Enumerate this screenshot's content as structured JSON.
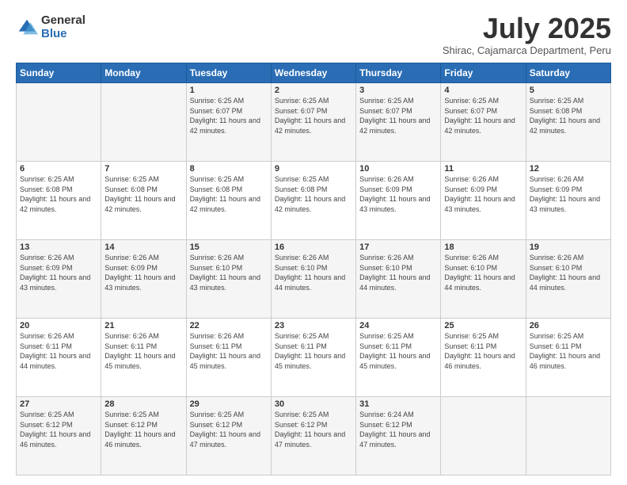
{
  "logo": {
    "general": "General",
    "blue": "Blue"
  },
  "header": {
    "month": "July 2025",
    "location": "Shirac, Cajamarca Department, Peru"
  },
  "days_of_week": [
    "Sunday",
    "Monday",
    "Tuesday",
    "Wednesday",
    "Thursday",
    "Friday",
    "Saturday"
  ],
  "weeks": [
    [
      {
        "day": "",
        "info": ""
      },
      {
        "day": "",
        "info": ""
      },
      {
        "day": "1",
        "info": "Sunrise: 6:25 AM\nSunset: 6:07 PM\nDaylight: 11 hours and 42 minutes."
      },
      {
        "day": "2",
        "info": "Sunrise: 6:25 AM\nSunset: 6:07 PM\nDaylight: 11 hours and 42 minutes."
      },
      {
        "day": "3",
        "info": "Sunrise: 6:25 AM\nSunset: 6:07 PM\nDaylight: 11 hours and 42 minutes."
      },
      {
        "day": "4",
        "info": "Sunrise: 6:25 AM\nSunset: 6:07 PM\nDaylight: 11 hours and 42 minutes."
      },
      {
        "day": "5",
        "info": "Sunrise: 6:25 AM\nSunset: 6:08 PM\nDaylight: 11 hours and 42 minutes."
      }
    ],
    [
      {
        "day": "6",
        "info": "Sunrise: 6:25 AM\nSunset: 6:08 PM\nDaylight: 11 hours and 42 minutes."
      },
      {
        "day": "7",
        "info": "Sunrise: 6:25 AM\nSunset: 6:08 PM\nDaylight: 11 hours and 42 minutes."
      },
      {
        "day": "8",
        "info": "Sunrise: 6:25 AM\nSunset: 6:08 PM\nDaylight: 11 hours and 42 minutes."
      },
      {
        "day": "9",
        "info": "Sunrise: 6:25 AM\nSunset: 6:08 PM\nDaylight: 11 hours and 42 minutes."
      },
      {
        "day": "10",
        "info": "Sunrise: 6:26 AM\nSunset: 6:09 PM\nDaylight: 11 hours and 43 minutes."
      },
      {
        "day": "11",
        "info": "Sunrise: 6:26 AM\nSunset: 6:09 PM\nDaylight: 11 hours and 43 minutes."
      },
      {
        "day": "12",
        "info": "Sunrise: 6:26 AM\nSunset: 6:09 PM\nDaylight: 11 hours and 43 minutes."
      }
    ],
    [
      {
        "day": "13",
        "info": "Sunrise: 6:26 AM\nSunset: 6:09 PM\nDaylight: 11 hours and 43 minutes."
      },
      {
        "day": "14",
        "info": "Sunrise: 6:26 AM\nSunset: 6:09 PM\nDaylight: 11 hours and 43 minutes."
      },
      {
        "day": "15",
        "info": "Sunrise: 6:26 AM\nSunset: 6:10 PM\nDaylight: 11 hours and 43 minutes."
      },
      {
        "day": "16",
        "info": "Sunrise: 6:26 AM\nSunset: 6:10 PM\nDaylight: 11 hours and 44 minutes."
      },
      {
        "day": "17",
        "info": "Sunrise: 6:26 AM\nSunset: 6:10 PM\nDaylight: 11 hours and 44 minutes."
      },
      {
        "day": "18",
        "info": "Sunrise: 6:26 AM\nSunset: 6:10 PM\nDaylight: 11 hours and 44 minutes."
      },
      {
        "day": "19",
        "info": "Sunrise: 6:26 AM\nSunset: 6:10 PM\nDaylight: 11 hours and 44 minutes."
      }
    ],
    [
      {
        "day": "20",
        "info": "Sunrise: 6:26 AM\nSunset: 6:11 PM\nDaylight: 11 hours and 44 minutes."
      },
      {
        "day": "21",
        "info": "Sunrise: 6:26 AM\nSunset: 6:11 PM\nDaylight: 11 hours and 45 minutes."
      },
      {
        "day": "22",
        "info": "Sunrise: 6:26 AM\nSunset: 6:11 PM\nDaylight: 11 hours and 45 minutes."
      },
      {
        "day": "23",
        "info": "Sunrise: 6:25 AM\nSunset: 6:11 PM\nDaylight: 11 hours and 45 minutes."
      },
      {
        "day": "24",
        "info": "Sunrise: 6:25 AM\nSunset: 6:11 PM\nDaylight: 11 hours and 45 minutes."
      },
      {
        "day": "25",
        "info": "Sunrise: 6:25 AM\nSunset: 6:11 PM\nDaylight: 11 hours and 46 minutes."
      },
      {
        "day": "26",
        "info": "Sunrise: 6:25 AM\nSunset: 6:11 PM\nDaylight: 11 hours and 46 minutes."
      }
    ],
    [
      {
        "day": "27",
        "info": "Sunrise: 6:25 AM\nSunset: 6:12 PM\nDaylight: 11 hours and 46 minutes."
      },
      {
        "day": "28",
        "info": "Sunrise: 6:25 AM\nSunset: 6:12 PM\nDaylight: 11 hours and 46 minutes."
      },
      {
        "day": "29",
        "info": "Sunrise: 6:25 AM\nSunset: 6:12 PM\nDaylight: 11 hours and 47 minutes."
      },
      {
        "day": "30",
        "info": "Sunrise: 6:25 AM\nSunset: 6:12 PM\nDaylight: 11 hours and 47 minutes."
      },
      {
        "day": "31",
        "info": "Sunrise: 6:24 AM\nSunset: 6:12 PM\nDaylight: 11 hours and 47 minutes."
      },
      {
        "day": "",
        "info": ""
      },
      {
        "day": "",
        "info": ""
      }
    ]
  ]
}
